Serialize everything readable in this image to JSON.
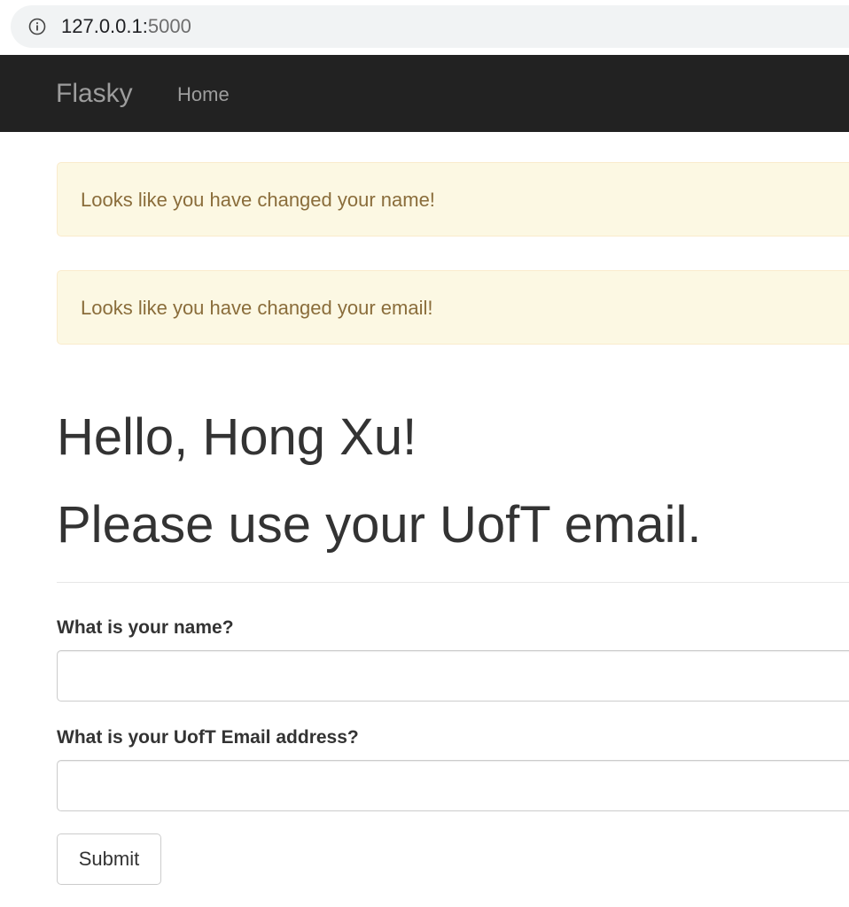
{
  "browser": {
    "url_host": "127.0.0.1:",
    "url_port": "5000",
    "info_icon": "info-circle-icon"
  },
  "navbar": {
    "brand": "Flasky",
    "home_label": "Home",
    "background": "#222222",
    "text_color": "#9d9d9d"
  },
  "alerts": [
    {
      "message": "Looks like you have changed your name!"
    },
    {
      "message": "Looks like you have changed your email!"
    }
  ],
  "alert_colors": {
    "background": "#fcf8e3",
    "border": "#faebcc",
    "text": "#8a6d3b"
  },
  "page": {
    "greeting": "Hello, Hong Xu!",
    "notice": "Please use your UofT email."
  },
  "form": {
    "name_label": "What is your name?",
    "name_value": "",
    "email_label": "What is your UofT Email address?",
    "email_value": "",
    "submit_label": "Submit"
  }
}
